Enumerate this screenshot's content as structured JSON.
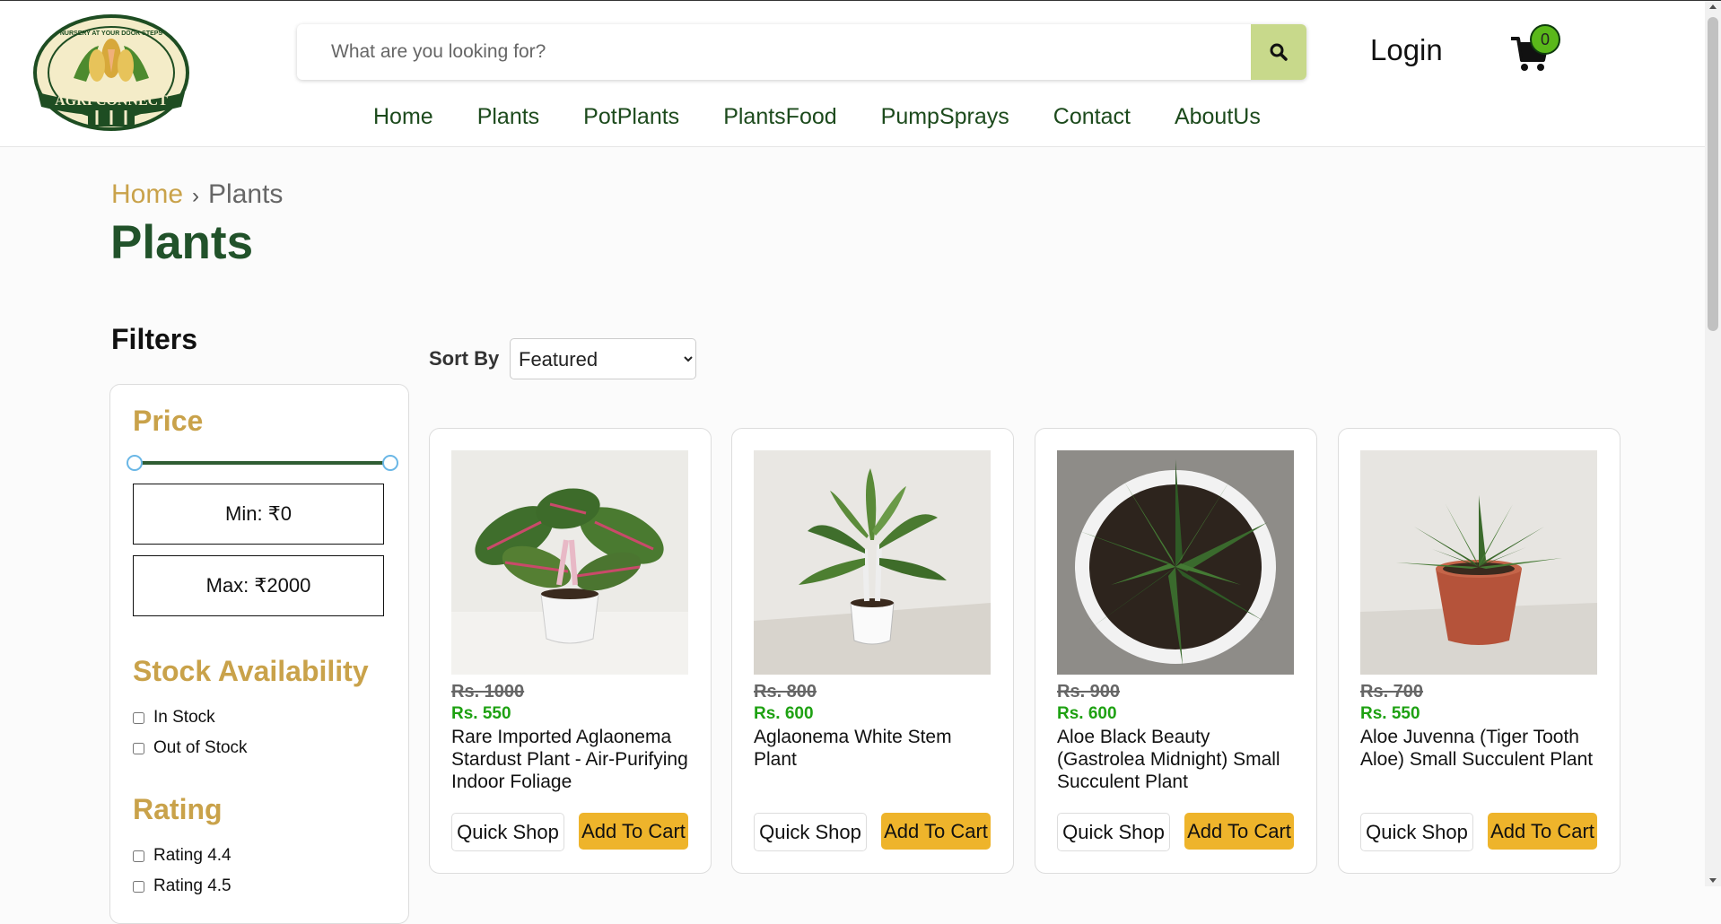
{
  "header": {
    "logo_text": "AGRI CONNECT",
    "logo_tagline": "NURSERY AT YOUR DOOR STEPS",
    "search_placeholder": "What are you looking for?",
    "search_icon": "search-icon",
    "login_label": "Login",
    "cart_icon": "cart-icon",
    "cart_count": "0",
    "accent_color": "#c8d98b"
  },
  "nav": {
    "items": [
      "Home",
      "Plants",
      "PotPlants",
      "PlantsFood",
      "PumpSprays",
      "Contact",
      "AboutUs"
    ]
  },
  "breadcrumb": {
    "home": "Home",
    "separator": "›",
    "current": "Plants"
  },
  "page_title": "Plants",
  "filters": {
    "title": "Filters",
    "price": {
      "heading": "Price",
      "min_label": "Min: ₹0",
      "max_label": "Max: ₹2000"
    },
    "stock": {
      "heading": "Stock Availability",
      "options": [
        "In Stock",
        "Out of Stock"
      ]
    },
    "rating": {
      "heading": "Rating",
      "options": [
        "Rating 4.4",
        "Rating 4.5"
      ]
    }
  },
  "sort": {
    "label": "Sort By",
    "selected": "Featured"
  },
  "products": [
    {
      "old_price": "Rs. 1000",
      "price": "Rs. 550",
      "name": "Rare Imported Aglaonema Stardust Plant - Air-Purifying Indoor Foliage",
      "quick_shop": "Quick Shop",
      "add_to_cart": "Add To Cart"
    },
    {
      "old_price": "Rs. 800",
      "price": "Rs. 600",
      "name": "Aglaonema White Stem Plant",
      "quick_shop": "Quick Shop",
      "add_to_cart": "Add To Cart"
    },
    {
      "old_price": "Rs. 900",
      "price": "Rs. 600",
      "name": "Aloe Black Beauty (Gastrolea Midnight) Small Succulent Plant",
      "quick_shop": "Quick Shop",
      "add_to_cart": "Add To Cart"
    },
    {
      "old_price": "Rs. 700",
      "price": "Rs. 550",
      "name": "Aloe Juvenna (Tiger Tooth Aloe) Small Succulent Plant",
      "quick_shop": "Quick Shop",
      "add_to_cart": "Add To Cart"
    }
  ],
  "colors": {
    "brand_green": "#21522a",
    "gold": "#c9a24a",
    "sale_green": "#1ea112",
    "cart_button": "#eeb42b"
  }
}
